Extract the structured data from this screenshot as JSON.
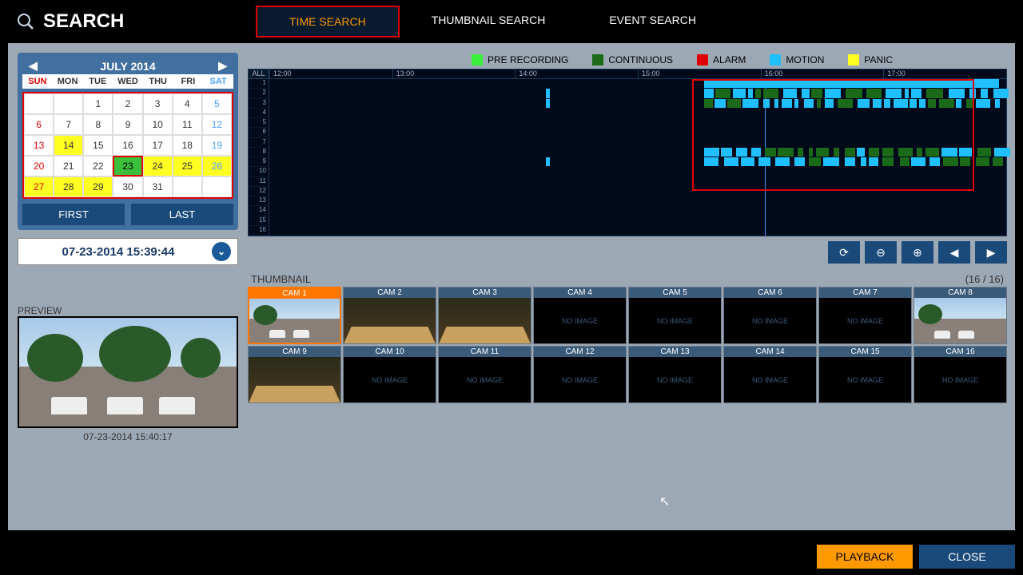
{
  "title": "SEARCH",
  "tabs": {
    "time": "TIME SEARCH",
    "thumb": "THUMBNAIL SEARCH",
    "event": "EVENT SEARCH"
  },
  "calendar": {
    "month": "JULY 2014",
    "days": [
      "SUN",
      "MON",
      "TUE",
      "WED",
      "THU",
      "FRI",
      "SAT"
    ],
    "first_btn": "FIRST",
    "last_btn": "LAST"
  },
  "datetime": "07-23-2014  15:39:44",
  "preview": {
    "label": "PREVIEW",
    "caption": "07-23-2014  15:40:17"
  },
  "legend": {
    "pre": "PRE RECORDING",
    "cont": "CONTINUOUS",
    "alarm": "ALARM",
    "motion": "MOTION",
    "panic": "PANIC"
  },
  "colors": {
    "pre": "#3af03a",
    "cont": "#1a6a1a",
    "alarm": "#e00000",
    "motion": "#20c0ff",
    "panic": "#ffff22"
  },
  "timeline": {
    "all": "ALL",
    "hours": [
      "12:00",
      "13:00",
      "14:00",
      "15:00",
      "16:00",
      "17:00"
    ]
  },
  "thumbnail": {
    "label": "THUMBNAIL",
    "count": "(16 / 16)",
    "no_image": "NO IMAGE",
    "cams": [
      "CAM 1",
      "CAM 2",
      "CAM 3",
      "CAM 4",
      "CAM 5",
      "CAM 6",
      "CAM 7",
      "CAM 8",
      "CAM 9",
      "CAM 10",
      "CAM 11",
      "CAM 12",
      "CAM 13",
      "CAM 14",
      "CAM 15",
      "CAM 16"
    ],
    "has_image": [
      true,
      true,
      true,
      false,
      false,
      false,
      false,
      true,
      true,
      false,
      false,
      false,
      false,
      false,
      false,
      false
    ]
  },
  "footer": {
    "playback": "PLAYBACK",
    "close": "CLOSE"
  }
}
